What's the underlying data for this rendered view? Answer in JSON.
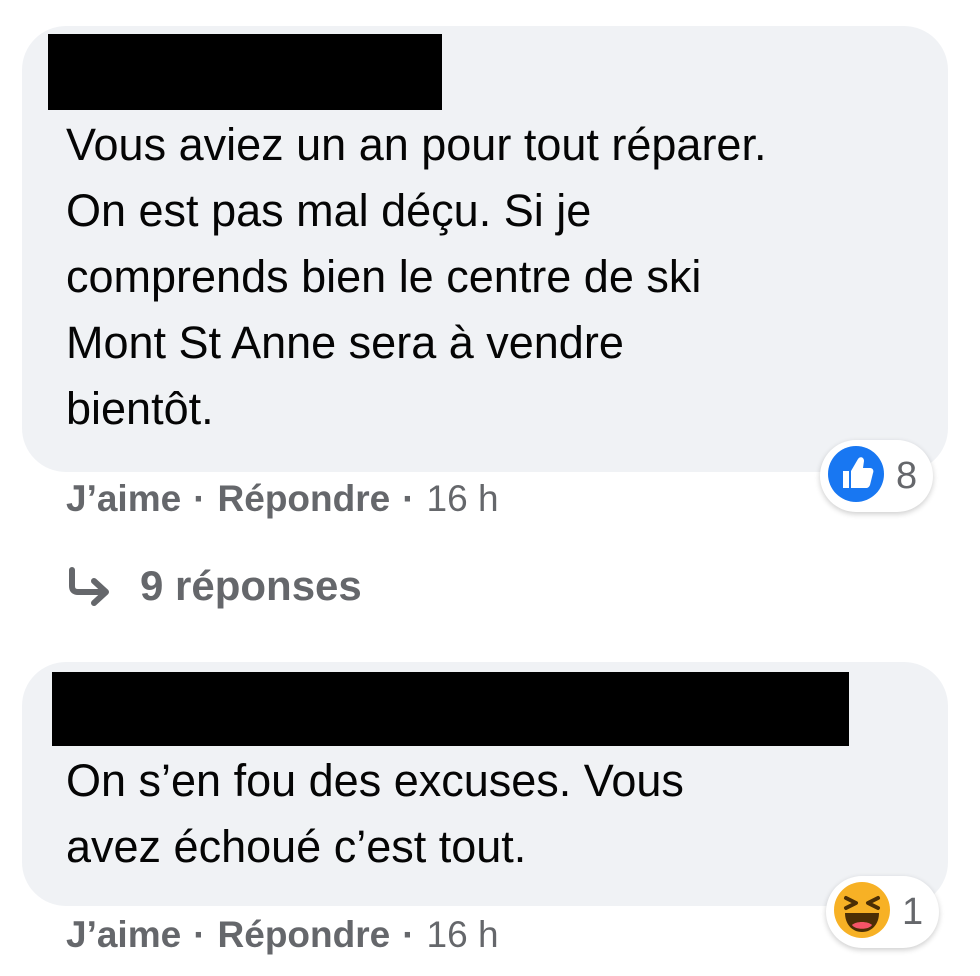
{
  "comments": [
    {
      "text": "Vous aviez un an pour tout réparer.\nOn est pas mal déçu. Si je\ncomprends bien le centre de ski\nMont St Anne sera à vendre\nbientôt.",
      "like_label": "J’aime",
      "reply_label": "Répondre",
      "separator": "·",
      "time": "16 h",
      "reaction": {
        "icon": "like-icon",
        "count": "8"
      },
      "replies_label": "9 réponses"
    },
    {
      "text": "On s’en fou des excuses. Vous\navez échoué c’est tout.",
      "like_label": "J’aime",
      "reply_label": "Répondre",
      "separator": "·",
      "time": "16 h",
      "reaction": {
        "icon": "haha-icon",
        "count": "1"
      }
    }
  ],
  "colors": {
    "bubble_bg": "#f0f2f5",
    "text": "#050505",
    "secondary": "#65676b",
    "like_blue": "#1877f2",
    "haha_yellow": "#f7b125"
  }
}
